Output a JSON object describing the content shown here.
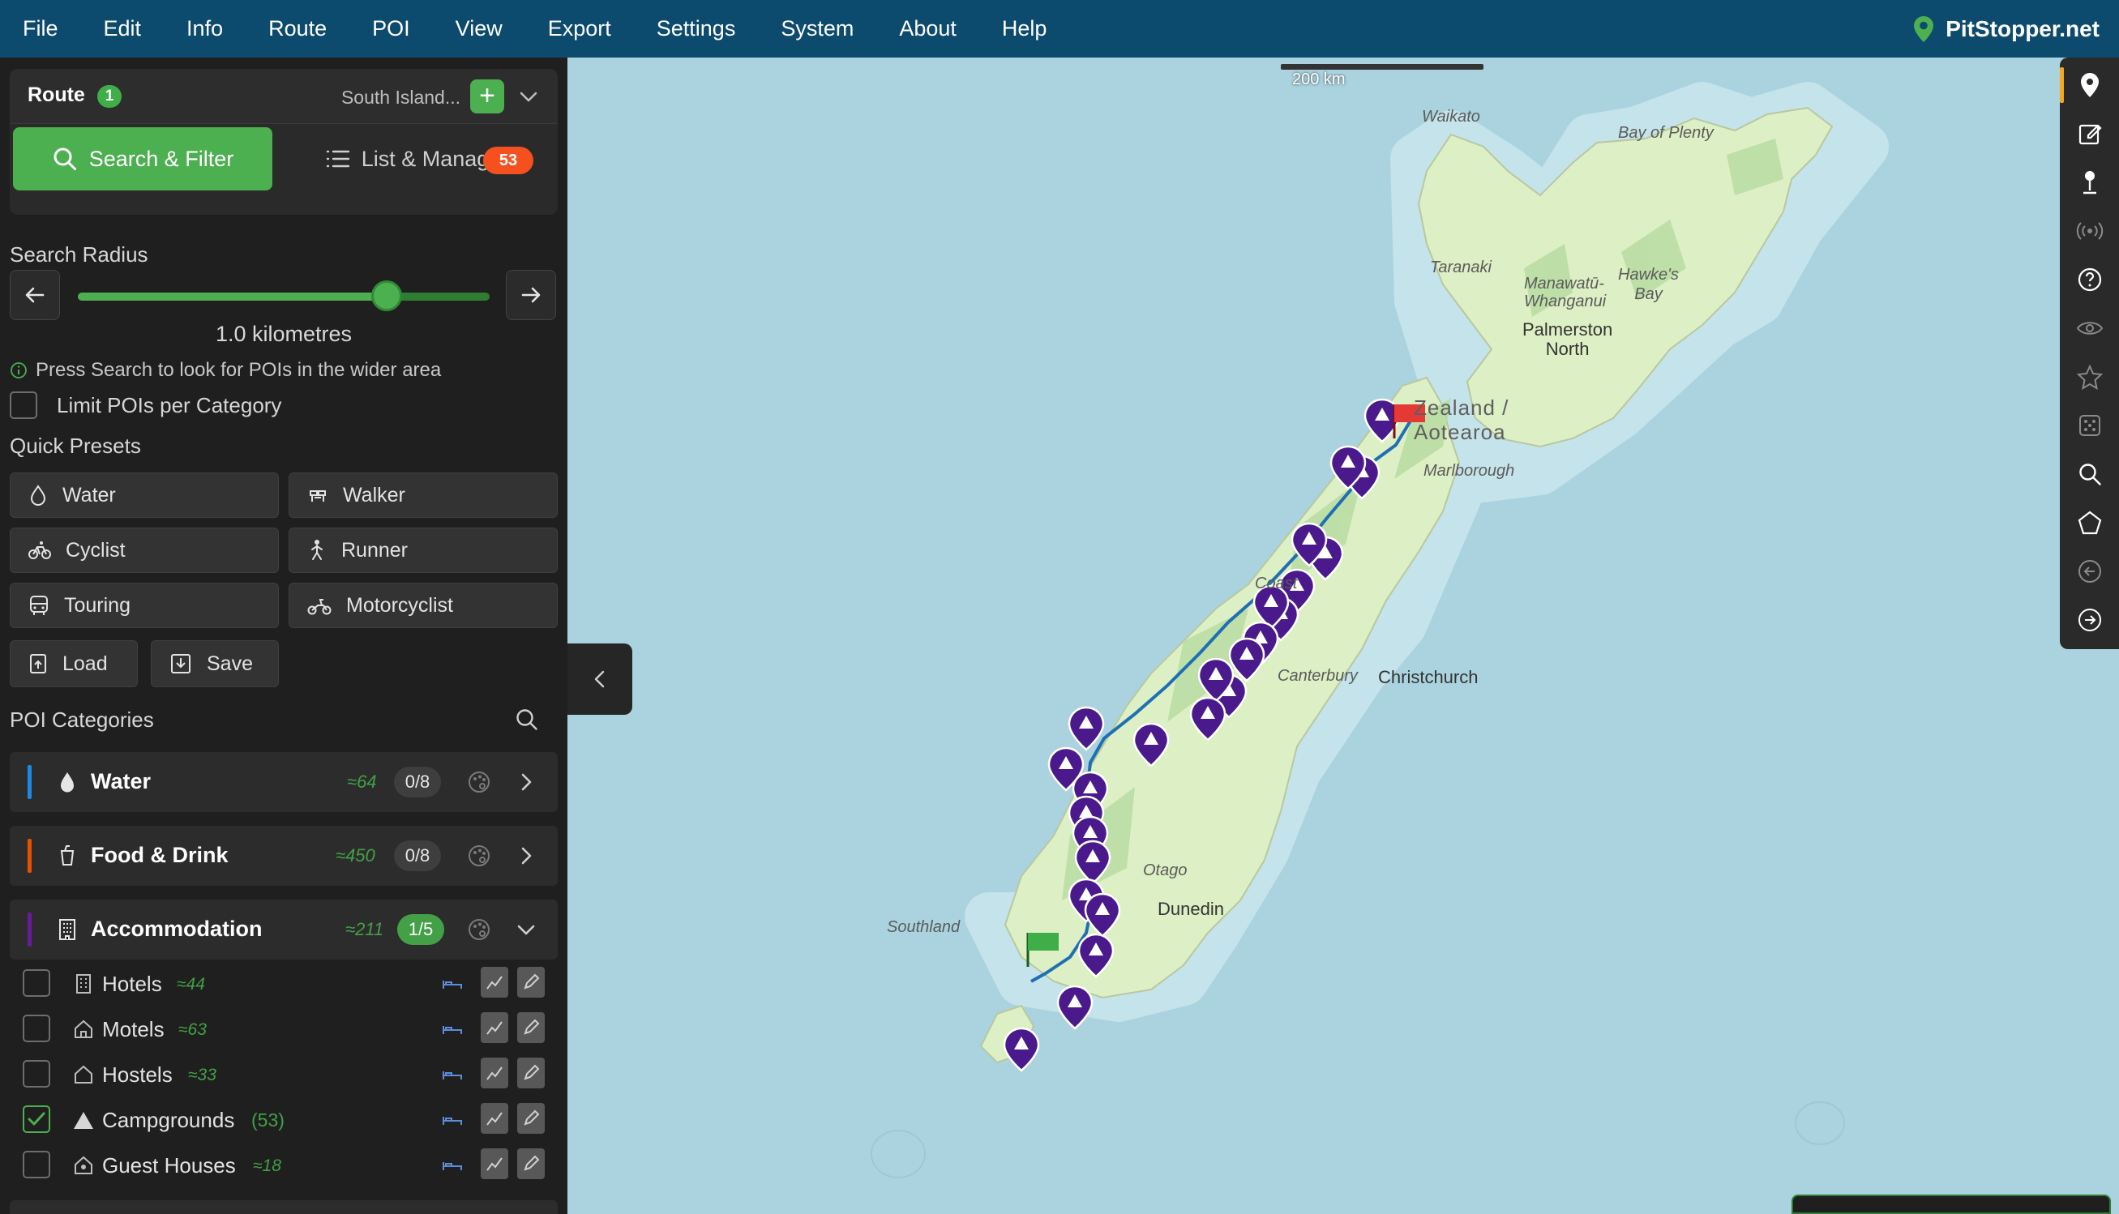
{
  "menu": [
    "File",
    "Edit",
    "Info",
    "Route",
    "POI",
    "View",
    "Export",
    "Settings",
    "System",
    "About",
    "Help"
  ],
  "brand": {
    "name": "PitStopper.net",
    "accent": "#4caf50"
  },
  "route": {
    "label": "Route",
    "count": "1",
    "name": "South Island...",
    "add_label": "+"
  },
  "tabs": {
    "search": "Search & Filter",
    "list": "List & Manage",
    "list_badge": "53"
  },
  "search_radius": {
    "label": "Search Radius",
    "value_text": "1.0 kilometres",
    "slider_fraction": 0.75,
    "hint": "Press Search to look for POIs in the wider area"
  },
  "limit_label": "Limit POIs per Category",
  "quick_presets": {
    "label": "Quick Presets",
    "items": [
      "Water",
      "Walker",
      "Cyclist",
      "Runner",
      "Touring",
      "Motorcyclist"
    ],
    "load": "Load",
    "save": "Save"
  },
  "poi_categories": {
    "label": "POI Categories",
    "rows": [
      {
        "name": "Water",
        "count": "≈64",
        "selected": "0/8",
        "color": "#1e88e5"
      },
      {
        "name": "Food & Drink",
        "count": "≈450",
        "selected": "0/8",
        "color": "#e65100"
      },
      {
        "name": "Accommodation",
        "count": "≈211",
        "selected": "1/5",
        "color": "#6a1b9a"
      }
    ],
    "sub_items": [
      {
        "name": "Hotels",
        "count": "≈44",
        "checked": false
      },
      {
        "name": "Motels",
        "count": "≈63",
        "checked": false
      },
      {
        "name": "Hostels",
        "count": "≈33",
        "checked": false
      },
      {
        "name": "Campgrounds",
        "count": "(53)",
        "checked": true
      },
      {
        "name": "Guest Houses",
        "count": "≈18",
        "checked": false
      }
    ]
  },
  "map": {
    "scale_label": "200 km",
    "regions": [
      "Waikato",
      "Bay of Plenty",
      "Taranaki",
      "Manawatū-\nWhanganui",
      "Hawke's\nBay",
      "Marlborough",
      "West Coast",
      "Canterbury",
      "Otago",
      "Southland"
    ],
    "cities": [
      "Palmerston\nNorth",
      "Christchurch",
      "Dunedin"
    ],
    "country": "Zealand /\nAotearoa",
    "coast_fragment": "Coast",
    "marker_color": "#4a1a8c",
    "route_color": "#1f6fb5",
    "start_flag_color": "#3fae49",
    "end_flag_color": "#e53935"
  },
  "toolbar": [
    "pin-icon",
    "edit-icon",
    "marker-icon",
    "broadcast-icon",
    "help-icon",
    "eye-icon",
    "star-icon",
    "dice-icon",
    "search-icon",
    "pentagon-icon",
    "back-icon",
    "forward-icon"
  ]
}
